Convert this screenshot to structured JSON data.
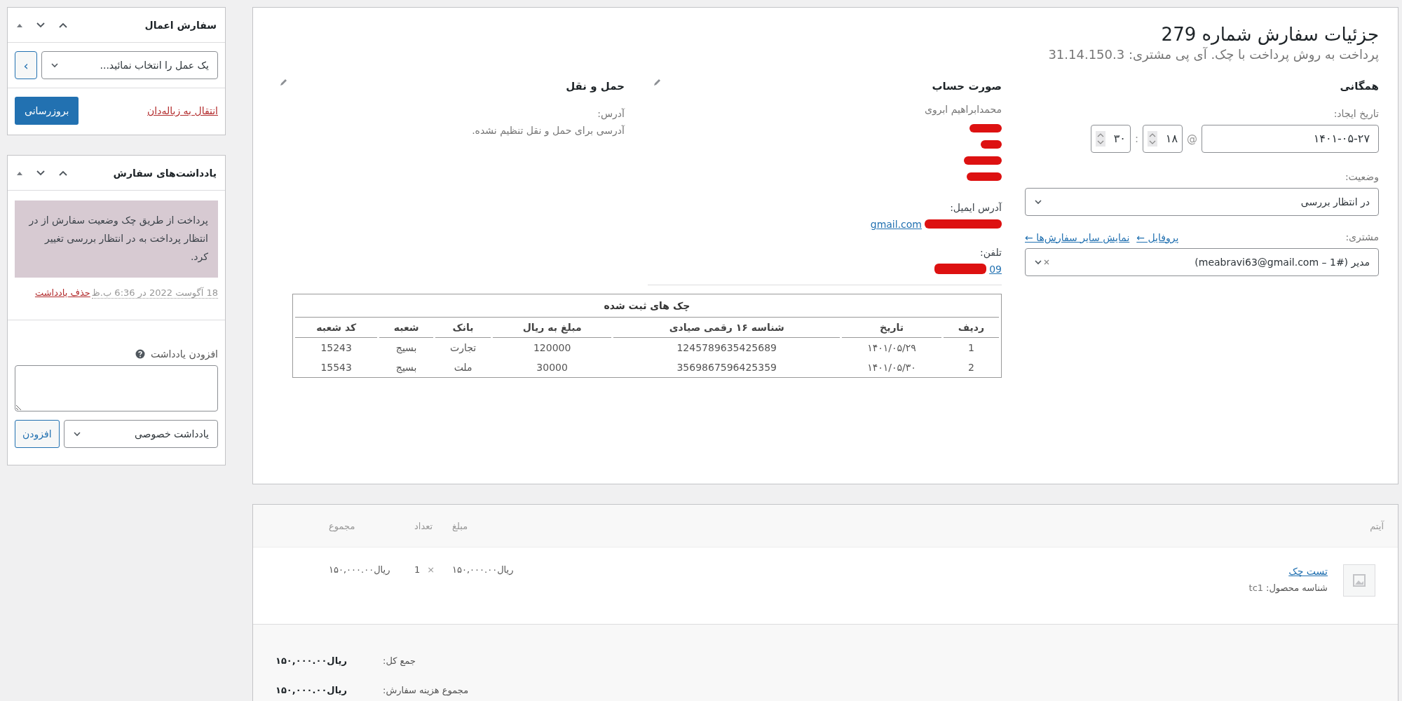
{
  "order": {
    "title": "جزئیات سفارش شماره 279",
    "subtitle": "پرداخت به روش پرداخت با چک. آی پی مشتری: 31.14.150.3",
    "general": {
      "heading": "همگانی",
      "date_label": "تاریخ ایجاد:",
      "date": "۱۴۰۱-۰۵-۲۷",
      "at": "@",
      "hour": "۱۸",
      "colon": ":",
      "minute": "۳۰",
      "status_label": "وضعیت:",
      "status": "در انتظار بررسی",
      "customer_label": "مشتری:",
      "customer_links": [
        {
          "text": "پروفایل ←"
        },
        {
          "text": "نمایش سایر سفارش‌ها ←"
        }
      ],
      "customer": "مدیر (#1 – meabravi63@gmail.com)"
    },
    "billing": {
      "heading": "صورت حساب",
      "name": "محمدابراهیم ابروی",
      "address_lines": [
        {
          "kind": "redacted"
        },
        {
          "kind": "redacted"
        },
        {
          "kind": "redacted"
        },
        {
          "kind": "redacted"
        }
      ],
      "email_label": "آدرس ایمیل:",
      "email": {
        "text": "gmail.com",
        "redacted": true
      },
      "phone_label": "تلفن:",
      "phone": {
        "text": "09",
        "redacted": true
      }
    },
    "shipping": {
      "heading": "حمل و نقل",
      "address_label": "آدرس:",
      "address": "آدرسی برای حمل و نقل تنظیم نشده."
    },
    "checks": {
      "title": "چک های ثبت شده",
      "columns": [
        "ردیف",
        "تاریخ",
        "شناسه ۱۶ رقمی صیادی",
        "مبلغ به ریال",
        "بانک",
        "شعبه",
        "کد شعبه"
      ],
      "rows": [
        [
          "1",
          "۱۴۰۱/۰۵/۲۹",
          "1245789635425689",
          "120000",
          "تجارت",
          "بسیج",
          "15243"
        ],
        [
          "2",
          "۱۴۰۱/۰۵/۳۰",
          "3569867596425359",
          "30000",
          "ملت",
          "بسیج",
          "15543"
        ]
      ]
    }
  },
  "items": {
    "columns": [
      "آیتم",
      "مبلغ",
      "تعداد",
      "مجموع"
    ],
    "rows": [
      {
        "name": "تست چک",
        "sku_label": "شناسه محصول:",
        "sku": "tc1",
        "cost": "ریال۱۵۰,۰۰۰.۰۰",
        "times": "×",
        "qty": "1",
        "total": "ریال۱۵۰,۰۰۰.۰۰"
      }
    ],
    "totals": [
      {
        "label": "جمع کل:",
        "value": "ریال۱۵۰,۰۰۰.۰۰"
      },
      {
        "label": "مجموع هزینه سفارش:",
        "value": "ریال۱۵۰,۰۰۰.۰۰"
      }
    ]
  },
  "sidebar": {
    "actions": {
      "title": "سفارش اعمال",
      "select": "یک عمل را انتخاب نمائید...",
      "go": "›",
      "trash": "انتقال به زباله‌دان",
      "update": "بروزرسانی"
    },
    "notes": {
      "title": "یادداشت‌های سفارش",
      "items": [
        {
          "text": "پرداخت از طریق چک وضعیت سفارش از در انتظار پرداخت به در انتظار بررسی تغییر کرد.",
          "meta": "18 آگوست 2022 در 6:36 ب.ظ",
          "delete": "حذف یادداشت"
        }
      ],
      "add_label": "افزودن یادداشت",
      "type": "یادداشت خصوصی",
      "add_button": "افزودن"
    }
  }
}
